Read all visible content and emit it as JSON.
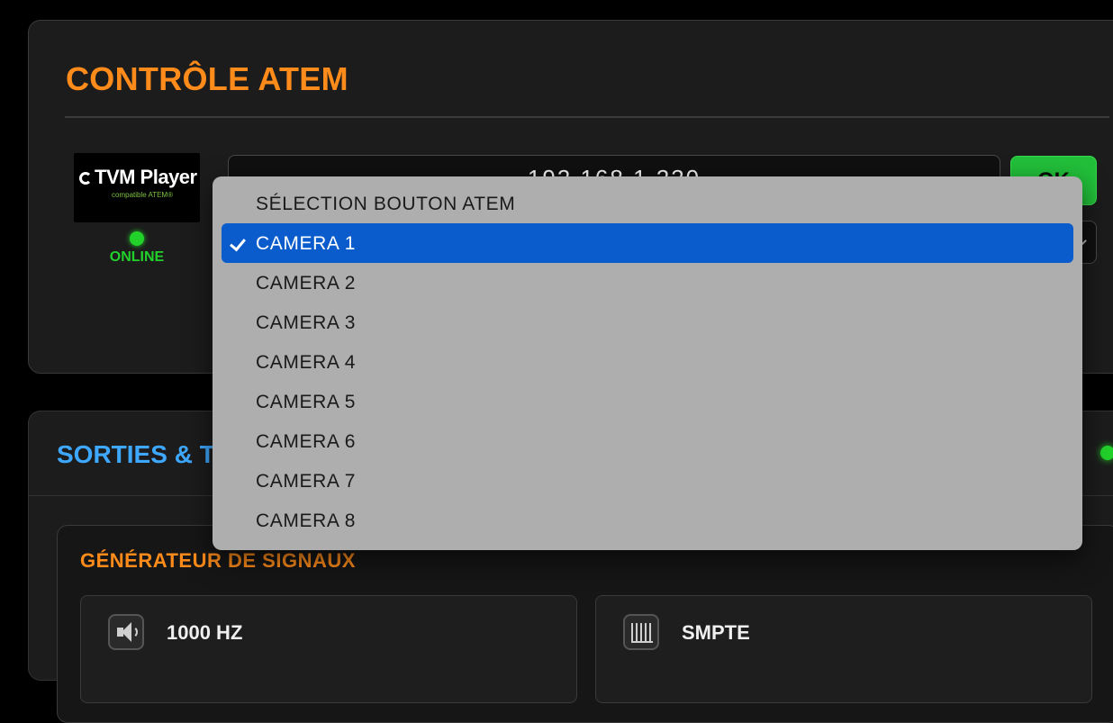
{
  "atem": {
    "title": "CONTRÔLE ATEM",
    "logo_name": "TVM Player",
    "logo_tagline": "compatible ATEM®",
    "status": "ONLINE",
    "ip_value": "192.168.1.230",
    "ok_label": "OK",
    "status_color": "#22d12a",
    "accent_color": "#ff8c1a"
  },
  "outputs": {
    "title_visible": "SORTIES & T",
    "title_color": "#3ea8ff",
    "signal_generator": {
      "heading": "GÉNÉRATEUR DE SIGNAUX",
      "tiles": [
        {
          "label": "1000 HZ",
          "icon": "speaker-icon"
        },
        {
          "label": "SMPTE",
          "icon": "color-bars-icon"
        }
      ]
    }
  },
  "dropdown": {
    "selected_index": 1,
    "selected_color": "#0a5ccc",
    "options": [
      "SÉLECTION BOUTON ATEM",
      "CAMERA 1",
      "CAMERA 2",
      "CAMERA 3",
      "CAMERA 4",
      "CAMERA 5",
      "CAMERA 6",
      "CAMERA 7",
      "CAMERA 8"
    ]
  }
}
